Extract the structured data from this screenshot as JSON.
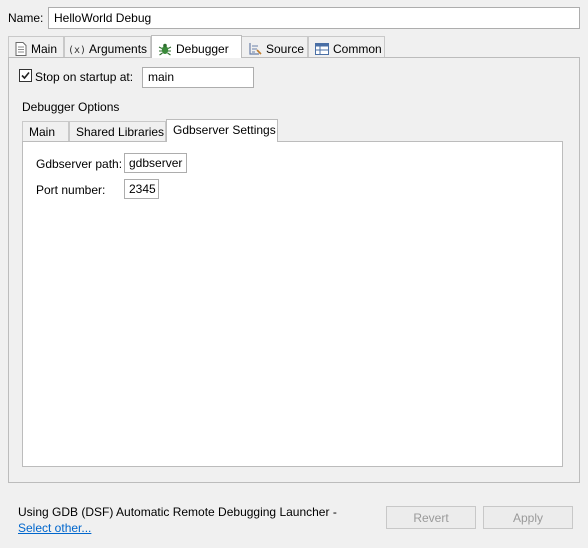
{
  "name_field": {
    "label": "Name:",
    "value": "HelloWorld Debug"
  },
  "tabs": [
    {
      "label": "Main",
      "icon": "page-icon"
    },
    {
      "label": "Arguments",
      "icon": "arguments-icon"
    },
    {
      "label": "Debugger",
      "icon": "bug-icon",
      "active": true
    },
    {
      "label": "Source",
      "icon": "source-icon"
    },
    {
      "label": "Common",
      "icon": "table-icon"
    }
  ],
  "stop_on_startup": {
    "label": "Stop on startup at:",
    "checked": true,
    "value": "main"
  },
  "debugger_options": {
    "group_label": "Debugger Options",
    "tabs": [
      {
        "label": "Main"
      },
      {
        "label": "Shared Libraries"
      },
      {
        "label": "Gdbserver Settings",
        "active": true
      }
    ],
    "gdbserver_path": {
      "label": "Gdbserver path:",
      "value": "gdbserver"
    },
    "port_number": {
      "label": "Port number:",
      "value": "2345"
    }
  },
  "footer": {
    "text": "Using GDB (DSF) Automatic Remote Debugging Launcher - ",
    "link": "Select other...",
    "revert_label": "Revert",
    "apply_label": "Apply"
  }
}
